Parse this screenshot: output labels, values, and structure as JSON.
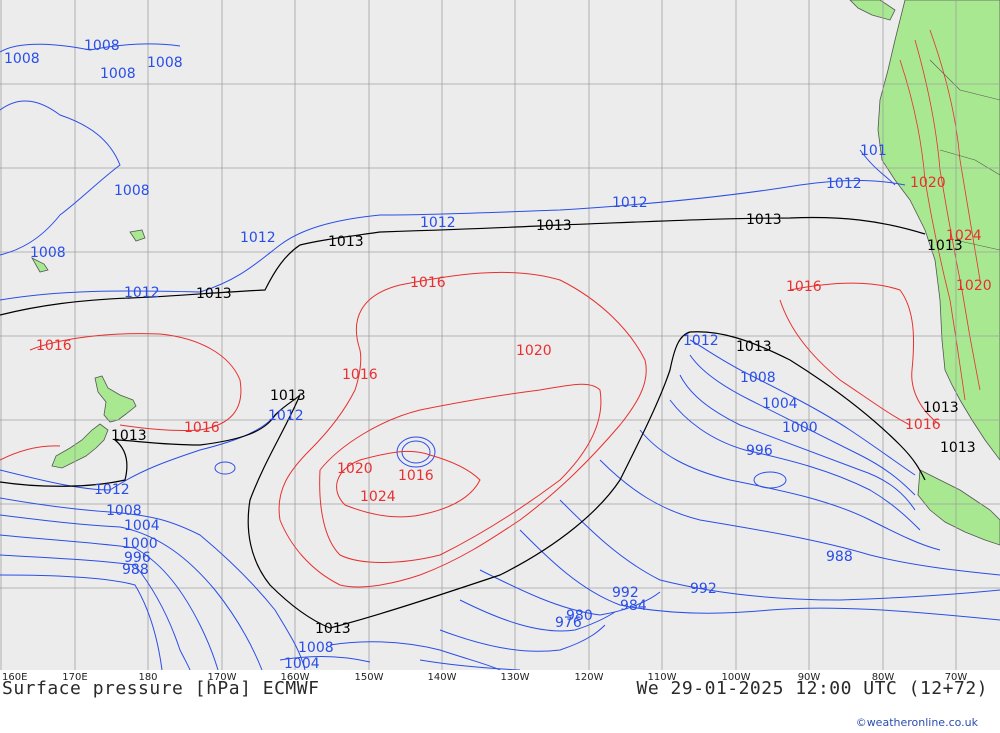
{
  "title": "Surface pressure [hPa] ECMWF",
  "valid_time": "We 29-01-2025 12:00 UTC (12+72)",
  "credit": "©weatheronline.co.uk",
  "longitude_labels": [
    "160E",
    "170E",
    "180",
    "170W",
    "160W",
    "150W",
    "140W",
    "130W",
    "120W",
    "110W",
    "100W",
    "90W",
    "80W",
    "70W"
  ],
  "colors": {
    "ocean": "#ececec",
    "land": "#a8e890",
    "grid": "#a0a0a0",
    "isobar_low": "#2a4ee8",
    "isobar_standard": "#000000",
    "isobar_high": "#e83030"
  },
  "isobar_labels": [
    {
      "text": "1008",
      "kind": "low"
    },
    {
      "text": "1008",
      "kind": "low"
    },
    {
      "text": "1008",
      "kind": "low"
    },
    {
      "text": "1008",
      "kind": "low"
    },
    {
      "text": "1008",
      "kind": "low"
    },
    {
      "text": "1008",
      "kind": "low"
    },
    {
      "text": "1012",
      "kind": "low"
    },
    {
      "text": "1012",
      "kind": "low"
    },
    {
      "text": "1012",
      "kind": "low"
    },
    {
      "text": "1012",
      "kind": "low"
    },
    {
      "text": "1012",
      "kind": "low"
    },
    {
      "text": "1012",
      "kind": "low"
    },
    {
      "text": "1012",
      "kind": "low"
    },
    {
      "text": "1012",
      "kind": "low"
    },
    {
      "text": "1013",
      "kind": "standard"
    },
    {
      "text": "1013",
      "kind": "standard"
    },
    {
      "text": "1013",
      "kind": "standard"
    },
    {
      "text": "1013",
      "kind": "standard"
    },
    {
      "text": "1013",
      "kind": "standard"
    },
    {
      "text": "1013",
      "kind": "standard"
    },
    {
      "text": "1013",
      "kind": "standard"
    },
    {
      "text": "1013",
      "kind": "standard"
    },
    {
      "text": "1013",
      "kind": "standard"
    },
    {
      "text": "1013",
      "kind": "standard"
    },
    {
      "text": "1013",
      "kind": "standard"
    },
    {
      "text": "1016",
      "kind": "high"
    },
    {
      "text": "1016",
      "kind": "high"
    },
    {
      "text": "1016",
      "kind": "high"
    },
    {
      "text": "1016",
      "kind": "high"
    },
    {
      "text": "1016",
      "kind": "high"
    },
    {
      "text": "1016",
      "kind": "high"
    },
    {
      "text": "1016",
      "kind": "high"
    },
    {
      "text": "1020",
      "kind": "high"
    },
    {
      "text": "1020",
      "kind": "high"
    },
    {
      "text": "1020",
      "kind": "high"
    },
    {
      "text": "1020",
      "kind": "high"
    },
    {
      "text": "1024",
      "kind": "high"
    },
    {
      "text": "1024",
      "kind": "high"
    },
    {
      "text": "1008",
      "kind": "low"
    },
    {
      "text": "1004",
      "kind": "low"
    },
    {
      "text": "1000",
      "kind": "low"
    },
    {
      "text": "996",
      "kind": "low"
    },
    {
      "text": "992",
      "kind": "low"
    },
    {
      "text": "988",
      "kind": "low"
    },
    {
      "text": "992",
      "kind": "low"
    },
    {
      "text": "988",
      "kind": "low"
    },
    {
      "text": "984",
      "kind": "low"
    },
    {
      "text": "980",
      "kind": "low"
    },
    {
      "text": "976",
      "kind": "low"
    },
    {
      "text": "1008",
      "kind": "low"
    },
    {
      "text": "1004",
      "kind": "low"
    },
    {
      "text": "1012",
      "kind": "low"
    },
    {
      "text": "1008",
      "kind": "low"
    },
    {
      "text": "1004",
      "kind": "low"
    },
    {
      "text": "1000",
      "kind": "low"
    },
    {
      "text": "996",
      "kind": "low"
    },
    {
      "text": "988",
      "kind": "low"
    },
    {
      "text": "101",
      "kind": "low"
    }
  ]
}
